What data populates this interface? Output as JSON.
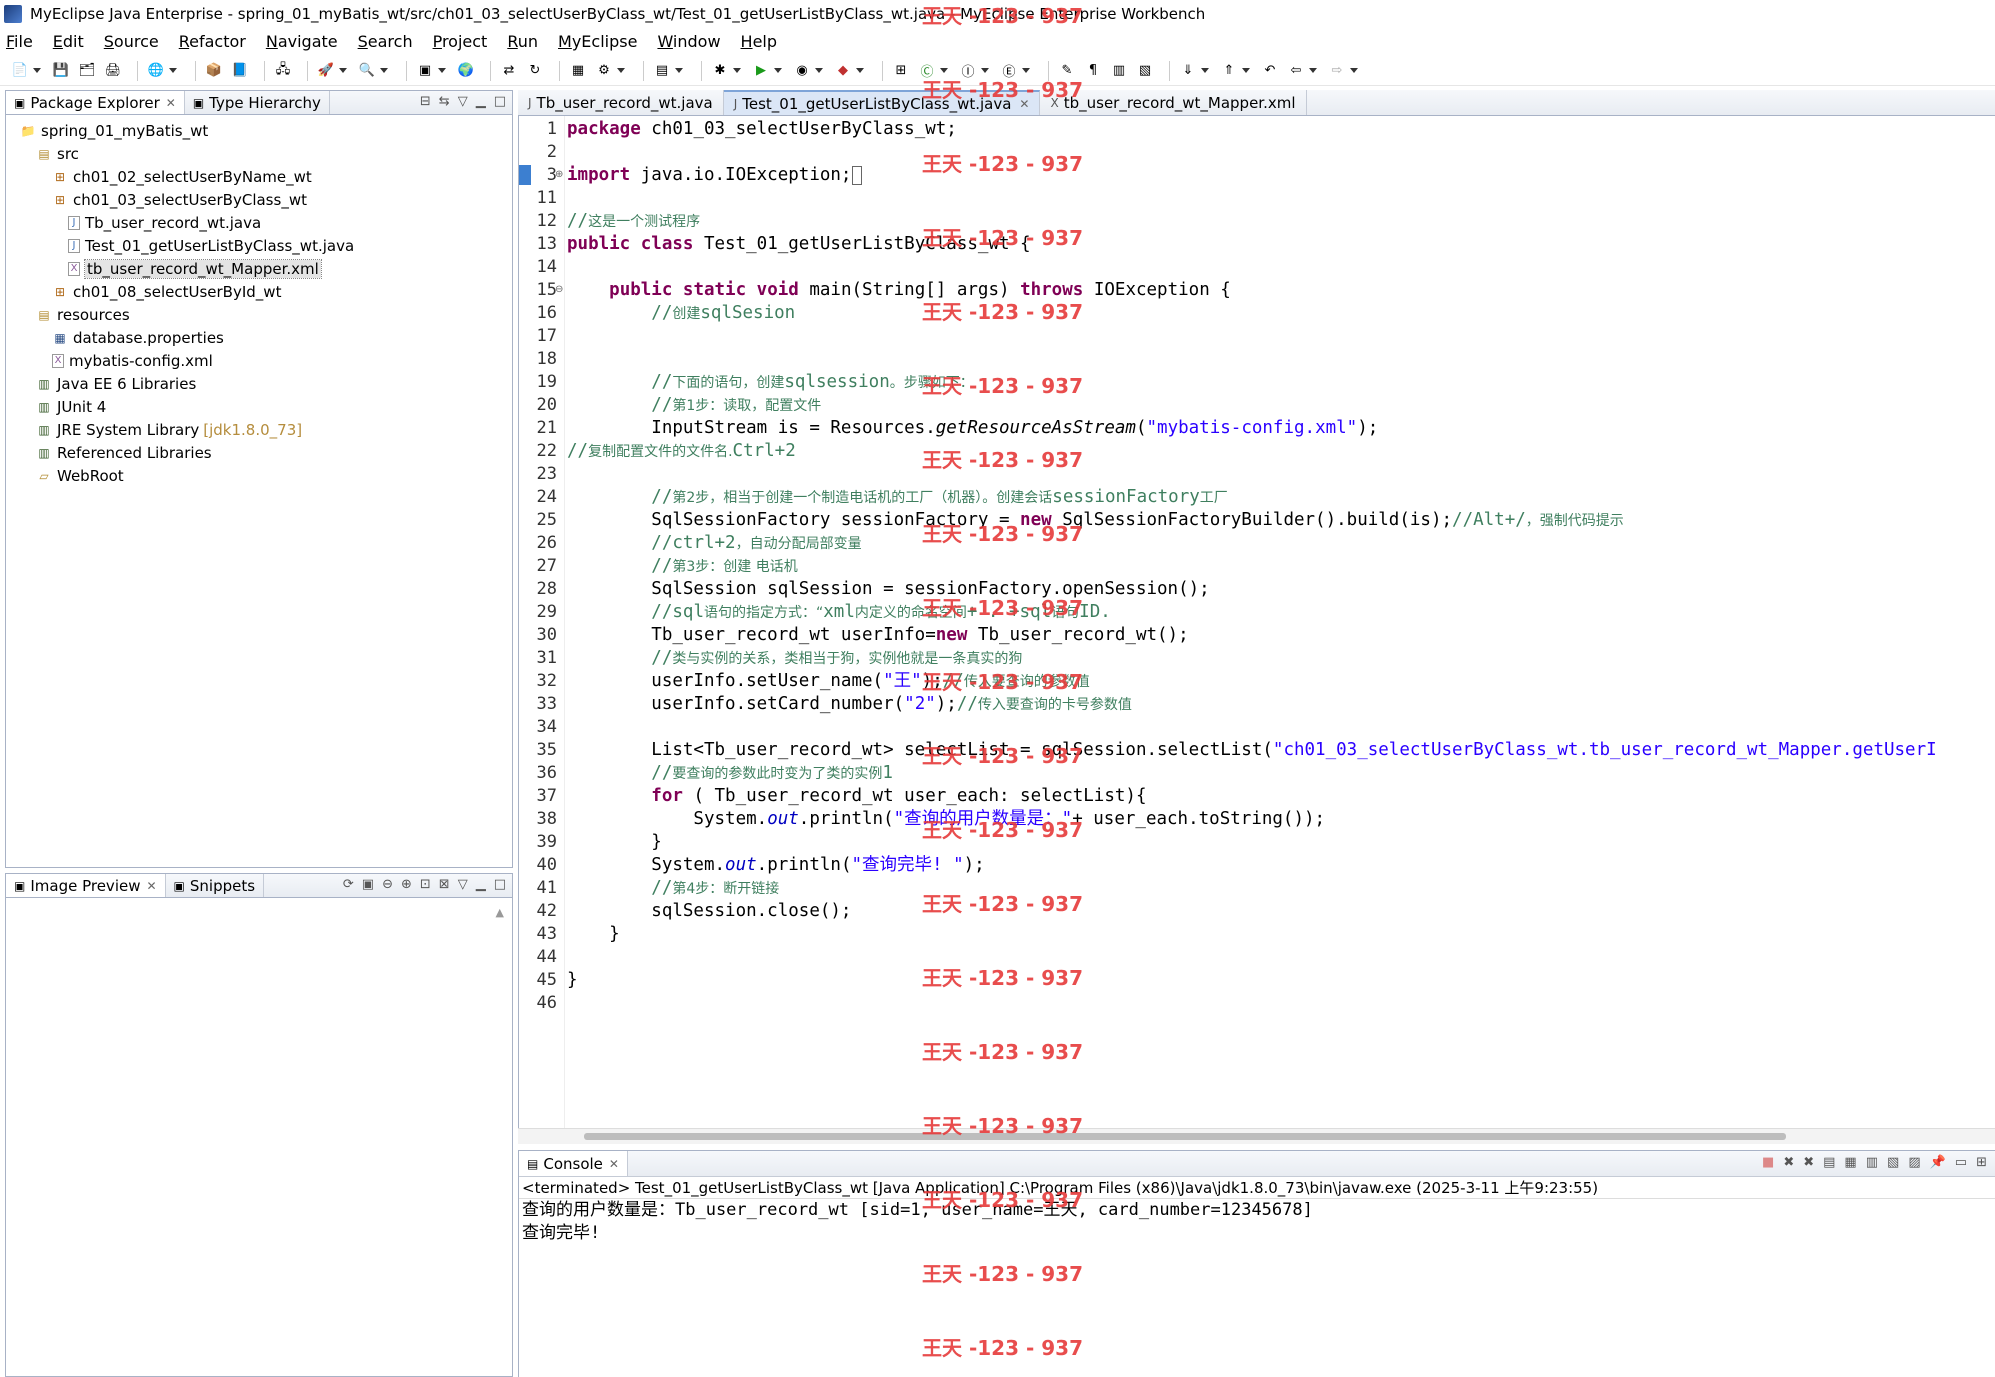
{
  "window": {
    "title": "MyEclipse Java Enterprise - spring_01_myBatis_wt/src/ch01_03_selectUserByClass_wt/Test_01_getUserListByClass_wt.java - MyEclipse Enterprise Workbench"
  },
  "menu": [
    "File",
    "Edit",
    "Source",
    "Refactor",
    "Navigate",
    "Search",
    "Project",
    "Run",
    "MyEclipse",
    "Window",
    "Help"
  ],
  "package_explorer": {
    "tabs": [
      {
        "label": "Package Explorer",
        "icon": "package-explorer-icon"
      },
      {
        "label": "Type Hierarchy",
        "icon": "type-hierarchy-icon"
      }
    ],
    "tree": [
      {
        "label": "spring_01_myBatis_wt",
        "depth": 0,
        "icon": "project-icon",
        "extra": ""
      },
      {
        "label": "src",
        "depth": 1,
        "icon": "source-folder-icon",
        "extra": ""
      },
      {
        "label": "ch01_02_selectUserByName_wt",
        "depth": 2,
        "icon": "package-icon",
        "extra": ""
      },
      {
        "label": "ch01_03_selectUserByClass_wt",
        "depth": 2,
        "icon": "package-icon",
        "extra": ""
      },
      {
        "label": "Tb_user_record_wt.java",
        "depth": 3,
        "icon": "java-file-icon",
        "extra": ""
      },
      {
        "label": "Test_01_getUserListByClass_wt.java",
        "depth": 3,
        "icon": "java-file-icon",
        "extra": ""
      },
      {
        "label": "tb_user_record_wt_Mapper.xml",
        "depth": 3,
        "icon": "xml-file-icon",
        "extra": "",
        "selected": true
      },
      {
        "label": "ch01_08_selectUserById_wt",
        "depth": 2,
        "icon": "package-icon",
        "extra": ""
      },
      {
        "label": "resources",
        "depth": 1,
        "icon": "source-folder-icon",
        "extra": ""
      },
      {
        "label": "database.properties",
        "depth": 2,
        "icon": "properties-file-icon",
        "extra": ""
      },
      {
        "label": "mybatis-config.xml",
        "depth": 2,
        "icon": "xml-file-icon",
        "extra": ""
      },
      {
        "label": "Java EE 6 Libraries",
        "depth": 1,
        "icon": "library-icon",
        "extra": ""
      },
      {
        "label": "JUnit 4",
        "depth": 1,
        "icon": "library-icon",
        "extra": ""
      },
      {
        "label": "JRE System Library",
        "depth": 1,
        "icon": "library-icon",
        "extra": "[jdk1.8.0_73]"
      },
      {
        "label": "Referenced Libraries",
        "depth": 1,
        "icon": "library-icon",
        "extra": ""
      },
      {
        "label": "WebRoot",
        "depth": 1,
        "icon": "folder-icon",
        "extra": ""
      }
    ]
  },
  "image_preview": {
    "tabs": [
      {
        "label": "Image Preview",
        "icon": "image-preview-icon"
      },
      {
        "label": "Snippets",
        "icon": "snippets-icon"
      }
    ]
  },
  "editor": {
    "tabs": [
      {
        "label": "Tb_user_record_wt.java",
        "active": false
      },
      {
        "label": "Test_01_getUserListByClass_wt.java",
        "active": true
      },
      {
        "label": "tb_user_record_wt_Mapper.xml",
        "active": false
      }
    ],
    "lines": [
      {
        "n": "1",
        "html": "<span class=\"kw\">package</span> ch01_03_selectUserByClass_wt;"
      },
      {
        "n": "2",
        "html": ""
      },
      {
        "n": "3",
        "html": "<span class=\"kw\">import</span> java.io.IOException;<span class=\"cursor-mark\"></span>",
        "fold": "⊕"
      },
      {
        "n": "11",
        "html": ""
      },
      {
        "n": "12",
        "html": "<span class=\"cm\">//</span><span class=\"cm-cn\">这是一个测试程序</span>"
      },
      {
        "n": "13",
        "html": "<span class=\"kw\">public class</span> Test_01_getUserListByClass_wt {"
      },
      {
        "n": "14",
        "html": ""
      },
      {
        "n": "15",
        "html": "    <span class=\"kw\">public static void</span> main(String[] args) <span class=\"kw\">throws</span> IOException {",
        "fold": "⊖"
      },
      {
        "n": "16",
        "html": "        <span class=\"cm\">//</span><span class=\"cm-cn\">创建</span><span class=\"cm\">sqlSesion</span>"
      },
      {
        "n": "17",
        "html": ""
      },
      {
        "n": "18",
        "html": ""
      },
      {
        "n": "19",
        "html": "        <span class=\"cm\">//</span><span class=\"cm-cn\">下面的语句，创建</span><span class=\"cm\">sqlsession</span><span class=\"cm-cn\">。步骤如下：</span>"
      },
      {
        "n": "20",
        "html": "        <span class=\"cm\">//</span><span class=\"cm-cn\">第1步：读取，配置文件</span>"
      },
      {
        "n": "21",
        "html": "        InputStream is = Resources.<span class=\"mi\">getResourceAsStream</span>(<span class=\"str\">\"mybatis-config.xml\"</span>);"
      },
      {
        "n": "22",
        "html": "<span class=\"cm\">//</span><span class=\"cm-cn\">复制配置文件的文件名.</span><span class=\"cm\">Ctrl+2</span>"
      },
      {
        "n": "23",
        "html": ""
      },
      {
        "n": "24",
        "html": "        <span class=\"cm\">//</span><span class=\"cm-cn\">第2步，相当于创建一个制造电话机的工厂（机器）。创建会话</span><span class=\"cm\">sessionFactory</span><span class=\"cm-cn\">工厂</span>"
      },
      {
        "n": "25",
        "html": "        SqlSessionFactory sessionFactory = <span class=\"kw\">new</span> SqlSessionFactoryBuilder().build(is);<span class=\"cm\">//Alt+/</span><span class=\"cm-cn\">，强制代码提示</span>"
      },
      {
        "n": "26",
        "html": "        <span class=\"cm\">//ctrl+2</span><span class=\"cm-cn\">，自动分配局部变量</span>"
      },
      {
        "n": "27",
        "html": "        <span class=\"cm\">//</span><span class=\"cm-cn\">第3步：创建 电话机</span>"
      },
      {
        "n": "28",
        "html": "        SqlSession sqlSession = sessionFactory.openSession();"
      },
      {
        "n": "29",
        "html": "        <span class=\"cm\">//sql</span><span class=\"cm-cn\">语句的指定方式：“</span><span class=\"cm\">xml</span><span class=\"cm-cn\">内定义的命名空间</span><span class=\"cm\">+ . +sql</span><span class=\"cm-cn\">语句</span><span class=\"cm\">ID.</span>"
      },
      {
        "n": "30",
        "html": "        Tb_user_record_wt userInfo=<span class=\"kw\">new</span> Tb_user_record_wt();"
      },
      {
        "n": "31",
        "html": "        <span class=\"cm\">//</span><span class=\"cm-cn\">类与实例的关系，类相当于狗，实例他就是一条真实的狗</span>"
      },
      {
        "n": "32",
        "html": "        userInfo.setUser_name(<span class=\"str\">\"王\"</span>);<span class=\"cm\">//</span><span class=\"cm-cn\">传入要查询的参数值</span>"
      },
      {
        "n": "33",
        "html": "        userInfo.setCard_number(<span class=\"str\">\"2\"</span>);<span class=\"cm\">//</span><span class=\"cm-cn\">传入要查询的卡号参数值</span>"
      },
      {
        "n": "34",
        "html": ""
      },
      {
        "n": "35",
        "html": "        List&lt;Tb_user_record_wt&gt; selectList = sqlSession.selectList(<span class=\"str\">\"ch01_03_selectUserByClass_wt.tb_user_record_wt_Mapper.getUserI</span>"
      },
      {
        "n": "36",
        "html": "        <span class=\"cm\">//</span><span class=\"cm-cn\">要查询的参数此时变为了类的实例</span><span class=\"cm\">1</span>"
      },
      {
        "n": "37",
        "html": "        <span class=\"kw\">for</span> ( Tb_user_record_wt user_each: selectList){"
      },
      {
        "n": "38",
        "html": "            System.<span class=\"it\">out</span>.println(<span class=\"str\">\"查询的用户数量是：\"</span>+ user_each.toString());"
      },
      {
        "n": "39",
        "html": "        }"
      },
      {
        "n": "40",
        "html": "        System.<span class=\"it\">out</span>.println(<span class=\"str\">\"查询完毕! \"</span>);"
      },
      {
        "n": "41",
        "html": "        <span class=\"cm\">//</span><span class=\"cm-cn\">第4步：断开链接</span>"
      },
      {
        "n": "42",
        "html": "        sqlSession.close();"
      },
      {
        "n": "43",
        "html": "    }"
      },
      {
        "n": "44",
        "html": ""
      },
      {
        "n": "45",
        "html": "}"
      },
      {
        "n": "46",
        "html": ""
      }
    ]
  },
  "console": {
    "tab_label": "Console",
    "status": "<terminated> Test_01_getUserListByClass_wt [Java Application] C:\\Program Files (x86)\\Java\\jdk1.8.0_73\\bin\\javaw.exe (2025-3-11 上午9:23:55)",
    "output": [
      "查询的用户数量是：Tb_user_record_wt [sid=1, user_name=王天, card_number=12345678]",
      "查询完毕!"
    ]
  },
  "watermark": "王天 -123 - 937"
}
